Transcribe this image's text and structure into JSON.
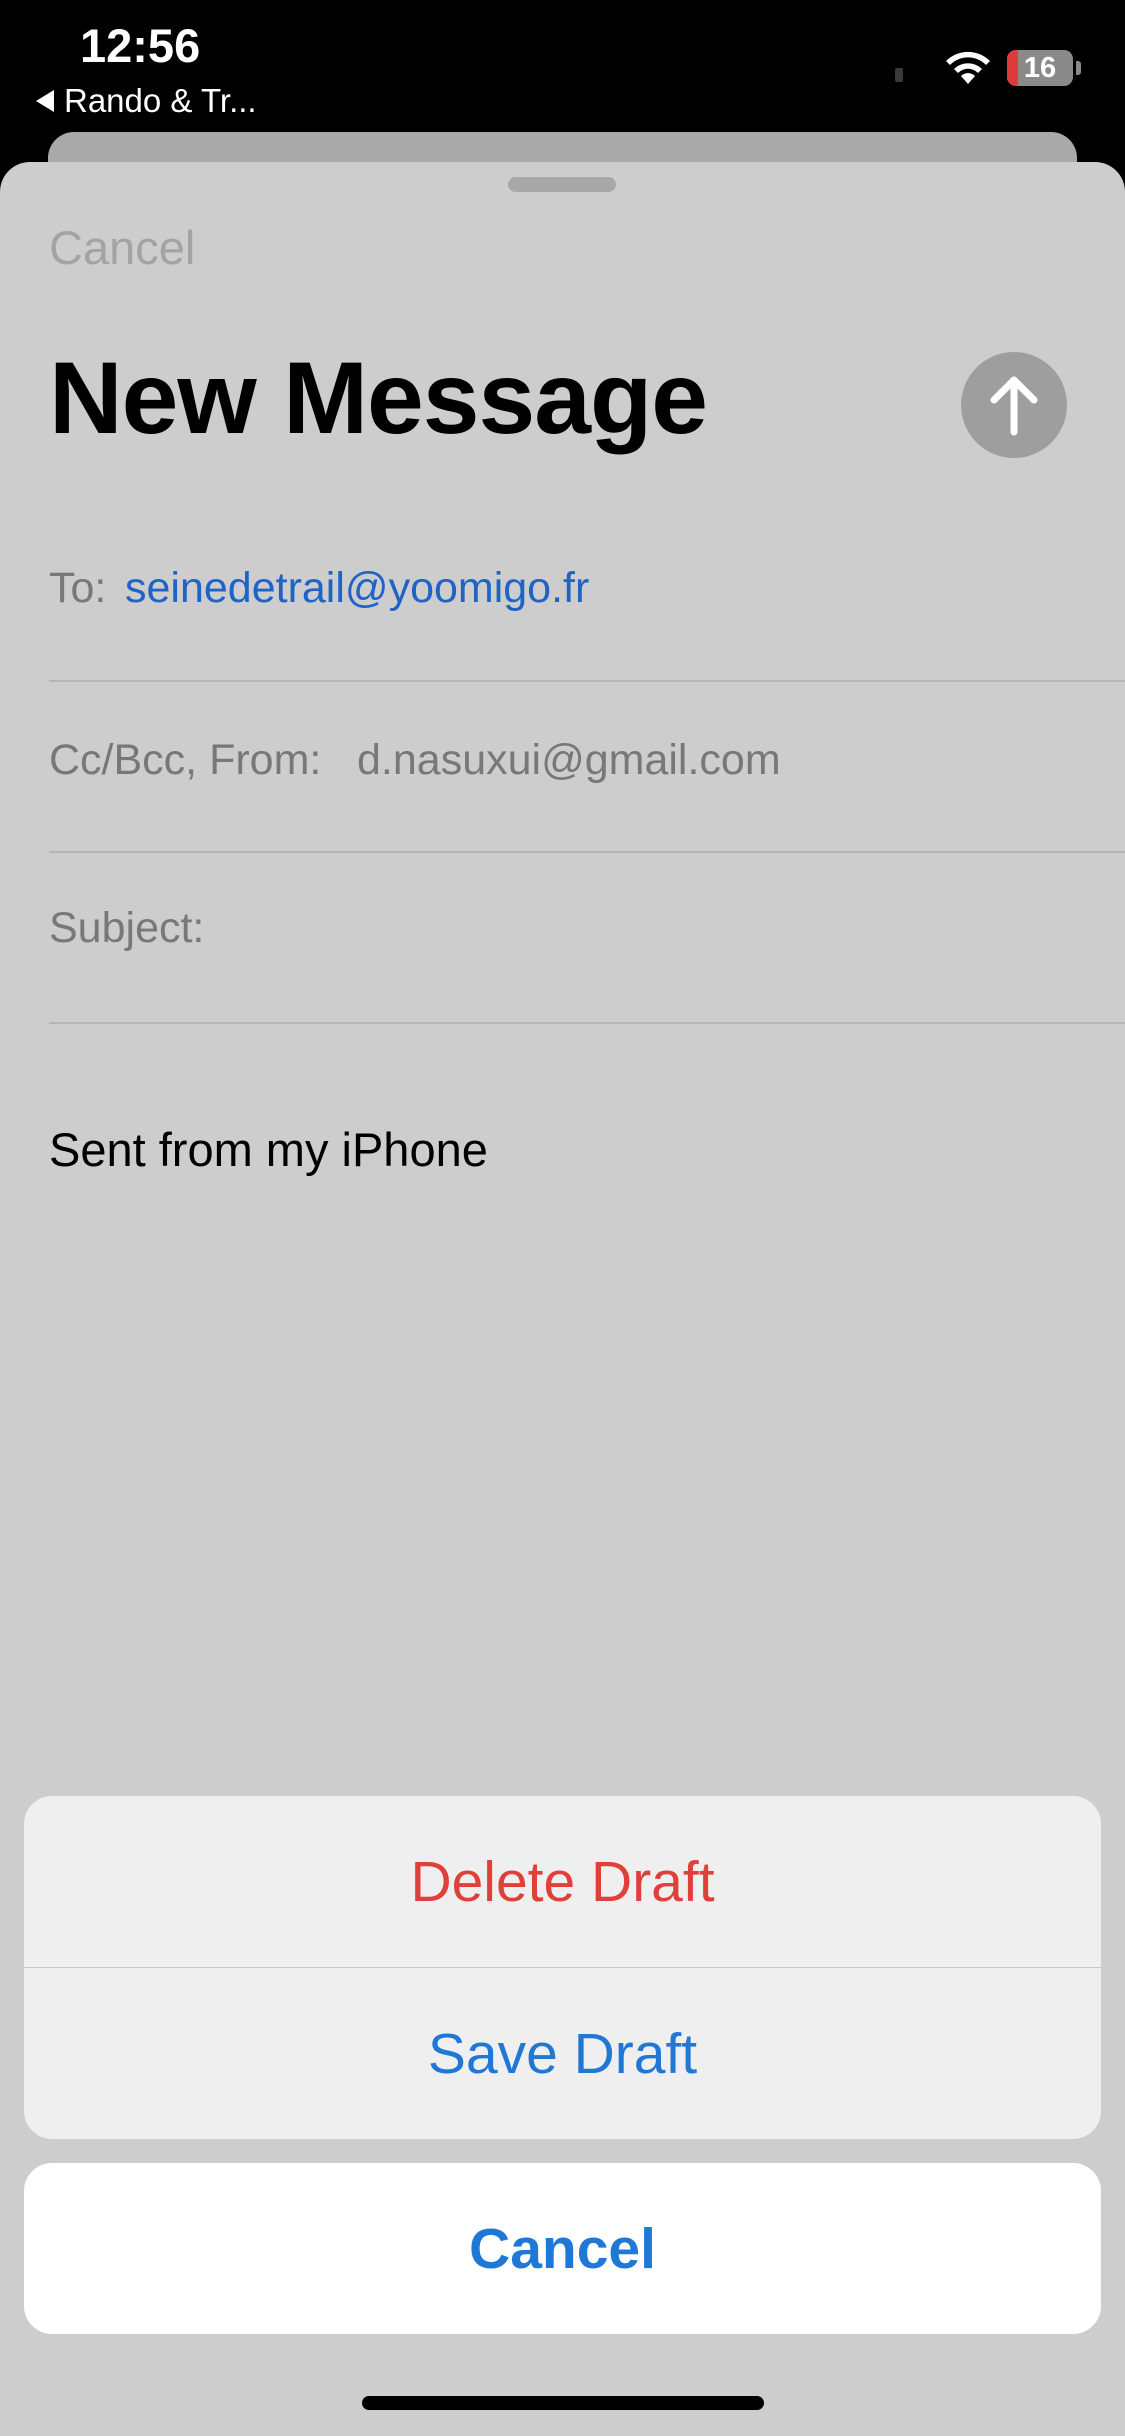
{
  "status_bar": {
    "time": "12:56",
    "back_app": "Rando & Tr...",
    "battery_level": "16",
    "battery_fraction": 0.16,
    "battery_color": "#e03a3a"
  },
  "compose": {
    "cancel_label": "Cancel",
    "title": "New Message",
    "to_label": "To:",
    "to_value": "seinedetrail@yoomigo.fr",
    "ccbcc_label": "Cc/Bcc, From:",
    "from_value": "d.nasuxui@gmail.com",
    "subject_label": "Subject:",
    "body": "Sent from my iPhone",
    "link_color": "#1f63c7"
  },
  "action_sheet": {
    "delete_label": "Delete Draft",
    "save_label": "Save Draft",
    "cancel_label": "Cancel",
    "destructive_color": "#e0403a",
    "action_color": "#1f77d6"
  },
  "icons": [
    "back-arrow-icon",
    "wifi-icon",
    "battery-icon",
    "send-arrow-icon"
  ]
}
